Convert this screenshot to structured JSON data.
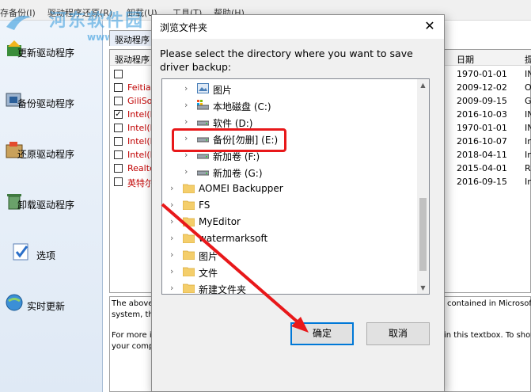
{
  "app": {
    "menu": [
      "存备份(I)",
      "驱动程序还原(R)",
      "卸载(U)",
      "工具(T)",
      "帮助(H)"
    ],
    "watermark_text": "河东软件园",
    "watermark_url": "www.pc0359.cn",
    "sidebar": [
      {
        "label": "更新驱动程序",
        "icon": "update-driver-icon"
      },
      {
        "label": "备份驱动程序",
        "icon": "backup-driver-icon"
      },
      {
        "label": "还原驱动程序",
        "icon": "restore-driver-icon"
      },
      {
        "label": "卸载驱动程序",
        "icon": "uninstall-driver-icon"
      },
      {
        "label": "选项",
        "icon": "options-icon"
      },
      {
        "label": "实时更新",
        "icon": "live-update-icon"
      }
    ],
    "driver_tab": "驱动程序",
    "columns": {
      "name": "驱动程序",
      "date": "日期",
      "provider": "提"
    },
    "rows": [
      {
        "checked": false,
        "name": "",
        "date": "1970-01-01",
        "provider": "IN"
      },
      {
        "checked": false,
        "name": "Feitian",
        "date": "2009-12-02",
        "provider": "O"
      },
      {
        "checked": false,
        "name": "GiliSo",
        "date": "2009-09-15",
        "provider": "G"
      },
      {
        "checked": true,
        "name": "Intel(R",
        "date": "2016-10-03",
        "provider": "IN"
      },
      {
        "checked": false,
        "name": "Intel(R",
        "date": "1970-01-01",
        "provider": "IN"
      },
      {
        "checked": false,
        "name": "Intel(R",
        "date": "2016-10-07",
        "provider": "In"
      },
      {
        "checked": false,
        "name": "Intel(R",
        "date": "2018-04-11",
        "provider": "In"
      },
      {
        "checked": false,
        "name": "Realte",
        "date": "2015-04-01",
        "provider": "R"
      },
      {
        "checked": false,
        "name": "英特尔",
        "date": "2016-09-15",
        "provider": "In"
      }
    ],
    "description": {
      "line1_left": "The above",
      "line1_right": "contained in Microsoft",
      "line2_left": "system, th",
      "line3_left": "For more in",
      "line3_right": "in this textbox. To show",
      "line4_left": "your comp"
    }
  },
  "dialog": {
    "title": "浏览文件夹",
    "close_glyph": "✕",
    "prompt": "Please select the directory where you want to save driver backup:",
    "tree": [
      {
        "label": "图片",
        "icon": "pictures-icon",
        "level": 2
      },
      {
        "label": "本地磁盘 (C:)",
        "icon": "system-drive-icon",
        "level": 2
      },
      {
        "label": "软件 (D:)",
        "icon": "drive-icon",
        "level": 2
      },
      {
        "label": "备份[勿删] (E:)",
        "icon": "drive-icon",
        "level": 2
      },
      {
        "label": "新加卷 (F:)",
        "icon": "drive-icon",
        "level": 2
      },
      {
        "label": "新加卷 (G:)",
        "icon": "drive-icon",
        "level": 2
      },
      {
        "label": "AOMEI Backupper",
        "icon": "folder-icon",
        "level": 1
      },
      {
        "label": "FS",
        "icon": "folder-icon",
        "level": 1
      },
      {
        "label": "MyEditor",
        "icon": "folder-icon",
        "level": 1
      },
      {
        "label": "watermarksoft",
        "icon": "folder-icon",
        "level": 1
      },
      {
        "label": "图片",
        "icon": "folder-icon",
        "level": 1
      },
      {
        "label": "文件",
        "icon": "folder-icon",
        "level": 1
      },
      {
        "label": "新建文件夹",
        "icon": "folder-icon",
        "level": 1
      }
    ],
    "ok_label": "确定",
    "cancel_label": "取消"
  },
  "colors": {
    "annotation": "#e8181a",
    "link_red": "#c00000",
    "focus_blue": "#0078d7"
  }
}
